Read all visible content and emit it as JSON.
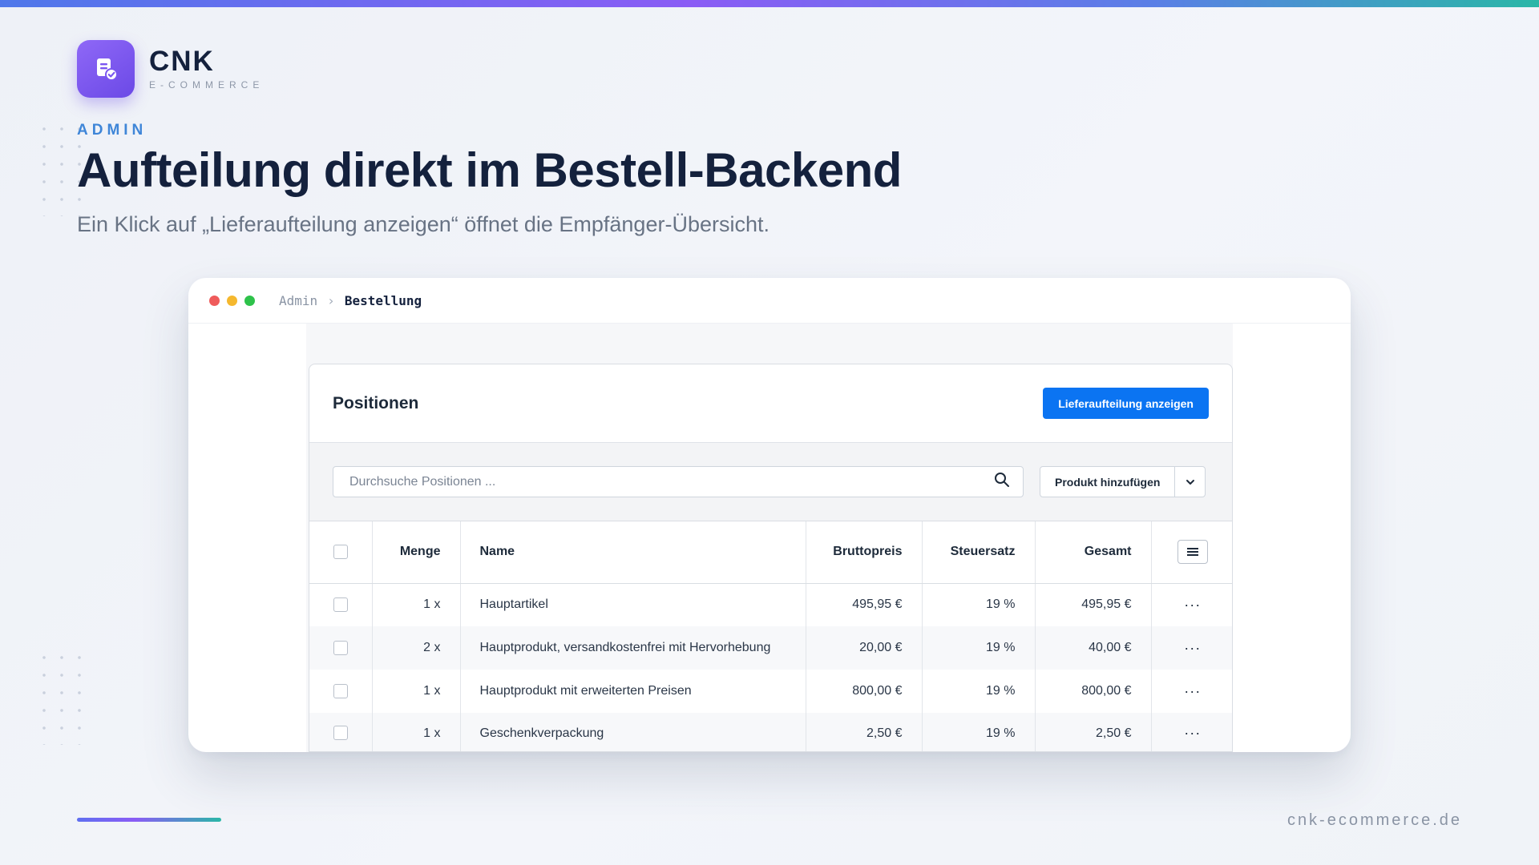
{
  "brand": {
    "name": "CNK",
    "tagline": "E-COMMERCE",
    "logo_icon": "document-check-icon",
    "accent": "#7a56f0"
  },
  "hero": {
    "eyebrow": "ADMIN",
    "headline": "Aufteilung direkt im Bestell-Backend",
    "subline": "Ein Klick auf „Lieferaufteilung anzeigen“ öffnet die Empfänger-Übersicht."
  },
  "window": {
    "traffic_lights": [
      "#ef5b5b",
      "#f5b82e",
      "#2ec24a"
    ],
    "breadcrumb": {
      "root": "Admin",
      "separator": "›",
      "current": "Bestellung"
    }
  },
  "panel": {
    "title": "Positionen",
    "primary_button": "Lieferaufteilung anzeigen",
    "primary_color": "#0b74f2",
    "search_placeholder": "Durchsuche Positionen ...",
    "add_button": "Produkt hinzufügen",
    "columns": {
      "quantity": "Menge",
      "name": "Name",
      "gross": "Bruttopreis",
      "tax": "Steuersatz",
      "total": "Gesamt"
    },
    "rows": [
      {
        "quantity": "1 x",
        "name": "Hauptartikel",
        "gross": "495,95 €",
        "tax": "19 %",
        "total": "495,95 €"
      },
      {
        "quantity": "2 x",
        "name": "Hauptprodukt, versandkostenfrei mit Hervorhebung",
        "gross": "20,00 €",
        "tax": "19 %",
        "total": "40,00 €"
      },
      {
        "quantity": "1 x",
        "name": "Hauptprodukt mit erweiterten Preisen",
        "gross": "800,00 €",
        "tax": "19 %",
        "total": "800,00 €"
      },
      {
        "quantity": "1 x",
        "name": "Geschenkverpackung",
        "gross": "2,50 €",
        "tax": "19 %",
        "total": "2,50 €"
      }
    ],
    "row_action": "···"
  },
  "footer": {
    "site": "cnk-ecommerce.de"
  }
}
